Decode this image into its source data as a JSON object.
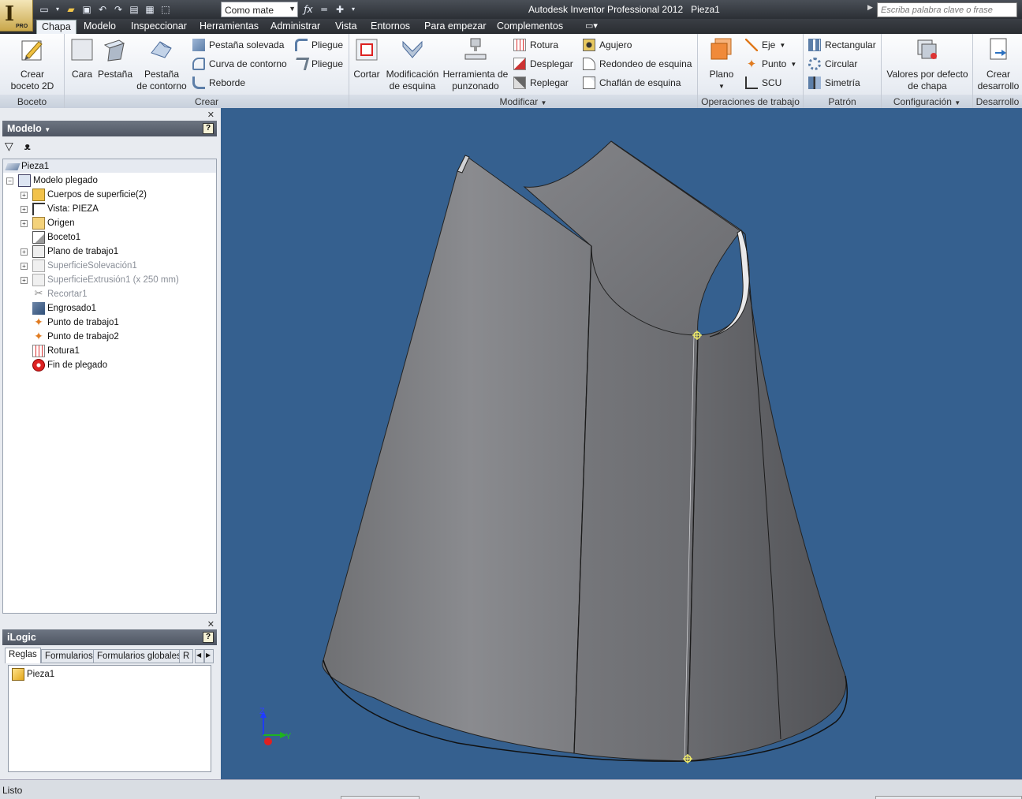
{
  "title_bar": {
    "app_title": "Autodesk Inventor Professional 2012",
    "document_name": "Pieza1",
    "material_select": "Como mate",
    "search_placeholder": "Escriba palabra clave o frase",
    "app_button_badge": "PRO"
  },
  "tabs": [
    "Chapa",
    "Modelo",
    "Inspeccionar",
    "Herramientas",
    "Administrar",
    "Vista",
    "Entornos",
    "Para empezar",
    "Complementos"
  ],
  "active_tab": "Chapa",
  "ribbon": {
    "boceto": {
      "title": "Boceto",
      "crear_boceto": "Crear\nboceto 2D"
    },
    "crear": {
      "title": "Crear",
      "cara": "Cara",
      "pestana": "Pestaña",
      "pestana_contorno": "Pestaña\nde contorno",
      "pestana_solevada": "Pestaña solevada",
      "curva_contorno": "Curva de contorno",
      "reborde": "Reborde",
      "pliegue1": "Pliegue",
      "pliegue2": "Pliegue"
    },
    "modificar": {
      "title": "Modificar",
      "cortar": "Cortar",
      "mod_esquina": "Modificación\nde esquina",
      "herr_punzonado": "Herramienta de\npunzonado",
      "rotura": "Rotura",
      "desplegar": "Desplegar",
      "replegar": "Replegar",
      "agujero": "Agujero",
      "redondeo": "Redondeo de esquina",
      "chaflan": "Chaflán de esquina"
    },
    "operaciones": {
      "title": "Operaciones de trabajo",
      "plano": "Plano",
      "eje": "Eje",
      "punto": "Punto",
      "scu": "SCU"
    },
    "patron": {
      "title": "Patrón",
      "rectangular": "Rectangular",
      "circular": "Circular",
      "simetria": "Simetría"
    },
    "configuracion": {
      "title": "Configuración",
      "valores": "Valores por defecto\nde chapa"
    },
    "desarrollo": {
      "title": "Desarrollo",
      "crear_desarrollo": "Crear\ndesarrollo"
    }
  },
  "model_browser": {
    "title": "Modelo",
    "root": "Pieza1",
    "items": [
      {
        "label": "Modelo plegado"
      },
      {
        "label": "Cuerpos de superficie(2)"
      },
      {
        "label": "Vista: PIEZA"
      },
      {
        "label": "Origen"
      },
      {
        "label": "Boceto1"
      },
      {
        "label": "Plano de trabajo1"
      },
      {
        "label": "SuperficieSolevación1"
      },
      {
        "label": "SuperficieExtrusión1 (x 250 mm)"
      },
      {
        "label": "Recortar1"
      },
      {
        "label": "Engrosado1"
      },
      {
        "label": "Punto de trabajo1"
      },
      {
        "label": "Punto de trabajo2"
      },
      {
        "label": "Rotura1"
      },
      {
        "label": "Fin de plegado"
      }
    ]
  },
  "ilogic": {
    "title": "iLogic",
    "tabs": [
      "Reglas",
      "Formularios",
      "Formularios globales",
      "R"
    ],
    "rule_item": "Pieza1"
  },
  "viewport": {
    "axis_z": "Z",
    "axis_y": "Y",
    "background": "#35608f",
    "part_color": "#7d7e82"
  },
  "status": {
    "text": "Listo"
  }
}
